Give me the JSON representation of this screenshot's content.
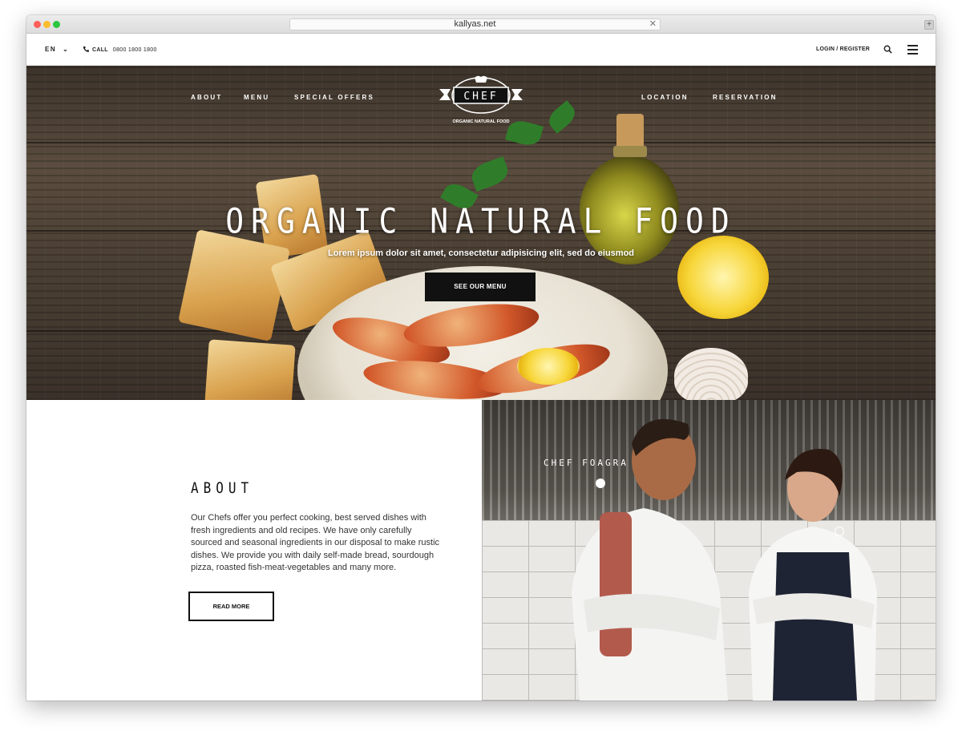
{
  "browser": {
    "url": "kallyas.net"
  },
  "topbar": {
    "language": "EN",
    "call_label": "CALL",
    "phone": "0800 1800 1800",
    "login": "LOGIN / REGISTER"
  },
  "nav": {
    "left": [
      "ABOUT",
      "MENU",
      "SPECIAL OFFERS"
    ],
    "right": [
      "LOCATION",
      "RESERVATION"
    ]
  },
  "logo": {
    "name": "CHEF",
    "tagline": "ORGANIC NATURAL FOOD"
  },
  "hero": {
    "title": "ORGANIC NATURAL FOOD",
    "subtitle": "Lorem ipsum dolor sit amet, consectetur adipisicing elit, sed do eiusmod",
    "button": "SEE OUR MENU"
  },
  "about": {
    "title": "ABOUT",
    "text": "Our Chefs offer you perfect cooking, best served dishes with fresh ingredients and old recipes. We have only carefully sourced and seasonal ingredients in our disposal to make rustic dishes. We provide you with daily self-made bread, sourdough pizza, roasted fish-meat-vegetables and many more.",
    "button": "READ MORE"
  },
  "chef_panel": {
    "label": "CHEF FOAGRA"
  },
  "icons": [
    "phone-icon",
    "chevron-down-icon",
    "search-icon",
    "menu-icon",
    "close-icon",
    "plus-icon"
  ]
}
